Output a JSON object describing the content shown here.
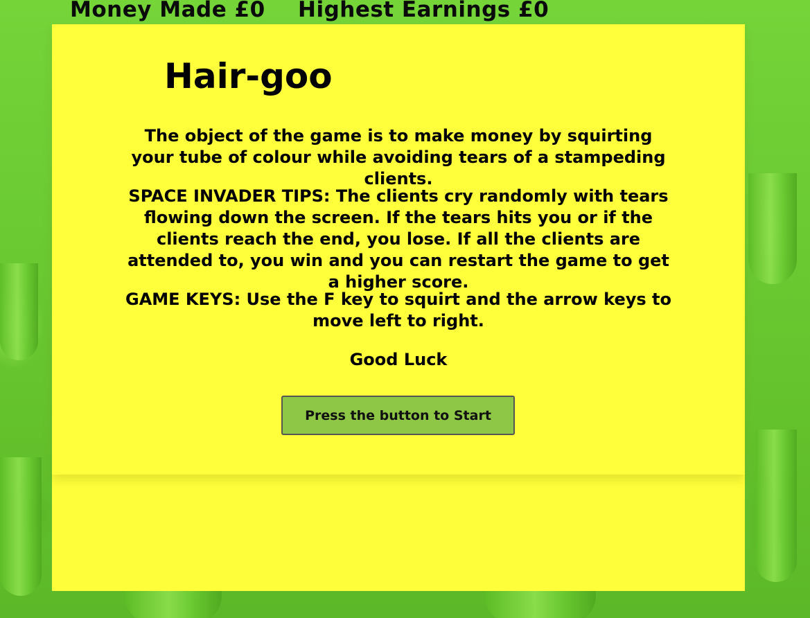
{
  "hud": {
    "money_made": "Money Made £0",
    "highest_earnings": "Highest Earnings £0"
  },
  "intro": {
    "title": "Hair-goo",
    "objective": "The object of the game is to make money by squirting your tube of colour while avoiding tears of a stampeding clients.",
    "tips": "SPACE INVADER TIPS: The clients cry randomly with tears flowing down the screen. If the tears hits you or if the clients reach the end, you lose. If all the clients are attended to, you win and you can restart the game to get a higher score.",
    "keys": "GAME KEYS: Use the F key to squirt and the arrow keys to move left to right.",
    "good_luck": "Good Luck",
    "start_label": "Press the button to Start"
  },
  "colors": {
    "background": "#6ccd34",
    "panel": "#ffff3b",
    "button": "#8dc745"
  }
}
